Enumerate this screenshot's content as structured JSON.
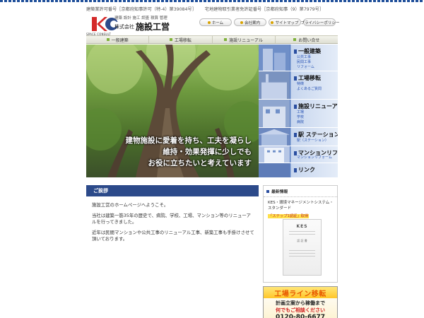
{
  "header": {
    "license_1": "建築業許可番号［京都府知事許可（特-4）第39084号］",
    "license_2": "宅地建物取引業者免許証番号［京都府知事（9）第7979号］",
    "logo_sub": "SPACE CONSULT",
    "company_services": "建築 設計 施工 調査 積算 管理",
    "company_type": "株式会社",
    "company_name": "施設工営"
  },
  "util_nav": [
    {
      "label": "ホーム"
    },
    {
      "label": "会社案内"
    },
    {
      "label": "サイトマップ"
    },
    {
      "label": "プライバシーポリシー"
    }
  ],
  "global_nav": [
    {
      "label": "一般建築"
    },
    {
      "label": "工場移転"
    },
    {
      "label": "施設リニューアル"
    },
    {
      "label": "お問い合せ"
    }
  ],
  "hero": {
    "line_1": "建物施設に愛着を持ち、工夫を凝らし",
    "line_2": "維持・効果発揮に少しでも",
    "line_3": "お役に立ちたいと考えています"
  },
  "side_menu": [
    {
      "title": "一般建築",
      "subs": [
        "公共工事",
        "民間工事",
        "リフォーム"
      ]
    },
    {
      "title": "工場移転",
      "subs": [
        "特徴",
        "よくあるご質問"
      ]
    },
    {
      "title": "施設リニューアル",
      "subs": [
        "工場",
        "学校",
        "病院"
      ]
    },
    {
      "title": "駅 ステーション",
      "subs": [
        "駅（ステーション）"
      ]
    },
    {
      "title": "マンションリフォーム",
      "subs": [
        "マンションリフォーム"
      ]
    },
    {
      "title": "リンク",
      "subs": []
    }
  ],
  "greeting": {
    "heading": "ご挨拶",
    "p1": "施設工営のホームページへようこそ。",
    "p2": "当社は建築一筋35年の歴史で、病院、学校、工場、マンション等のリニューアルを行ってきました。",
    "p3": "近年は民間マンションや公共工事のリニューアル工事、新築工事も手掛けさせて頂いております。"
  },
  "news": {
    "heading": "最新情報",
    "title": "KES・環境マネージメントシステム・スタンダード",
    "badge": "「ステップ1認証」取得",
    "doc_title": "KES",
    "doc_label": "認 証 書"
  },
  "banner": {
    "title": "工場ライン移転",
    "line_1": "計画立案から稼働まで",
    "line_2": "何でもご相談ください",
    "tel": "0120-80-6677"
  },
  "colors": {
    "primary": "#2c4a8a",
    "accent_green": "#7fb23a",
    "link_blue": "#2a55b5",
    "banner_orange": "#e85a00"
  }
}
